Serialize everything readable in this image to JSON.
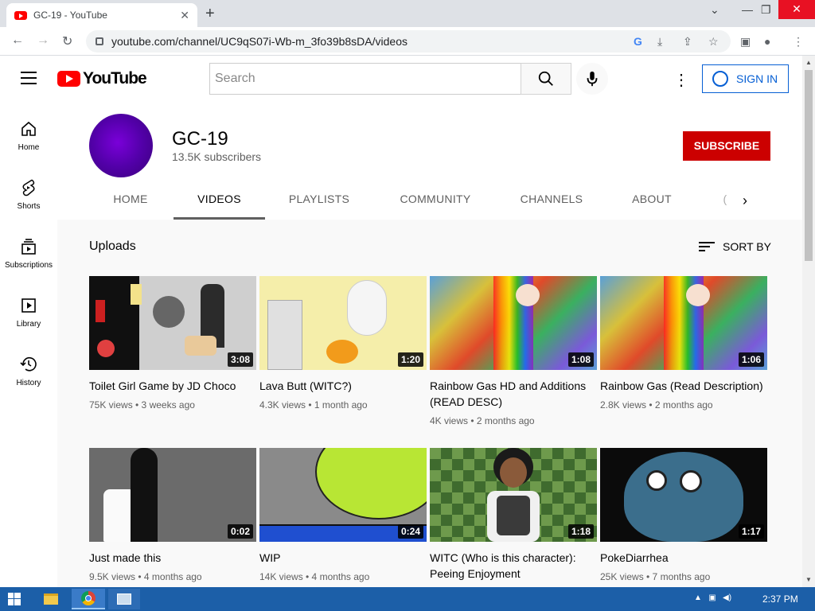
{
  "browser": {
    "tab_title": "GC-19 - YouTube",
    "close_glyph": "✕",
    "new_tab_glyph": "+",
    "url": "youtube.com/channel/UC9qS07i-Wb-m_3fo39b8sDA/videos"
  },
  "masthead": {
    "logo_text": "YouTube",
    "search_placeholder": "Search",
    "sign_in": "SIGN IN"
  },
  "guide": {
    "items": [
      {
        "label": "Home"
      },
      {
        "label": "Shorts"
      },
      {
        "label": "Subscriptions"
      },
      {
        "label": "Library"
      },
      {
        "label": "History"
      }
    ]
  },
  "channel": {
    "name": "GC-19",
    "subscribers": "13.5K subscribers",
    "subscribe_label": "SUBSCRIBE",
    "tabs": [
      "HOME",
      "VIDEOS",
      "PLAYLISTS",
      "COMMUNITY",
      "CHANNELS",
      "ABOUT"
    ],
    "active_tab": "VIDEOS"
  },
  "content": {
    "section_title": "Uploads",
    "sort_label": "SORT BY",
    "videos": [
      {
        "title": "Toilet Girl Game by JD Choco",
        "meta": "75K views • 3 weeks ago",
        "duration": "3:08"
      },
      {
        "title": "Lava Butt (WITC?)",
        "meta": "4.3K views • 1 month ago",
        "duration": "1:20"
      },
      {
        "title": "Rainbow Gas HD and Additions (READ DESC)",
        "meta": "4K views • 2 months ago",
        "duration": "1:08"
      },
      {
        "title": "Rainbow Gas (Read Description)",
        "meta": "2.8K views • 2 months ago",
        "duration": "1:06"
      },
      {
        "title": "Just made this",
        "meta": "9.5K views • 4 months ago",
        "duration": "0:02"
      },
      {
        "title": "WIP",
        "meta": "14K views • 4 months ago",
        "duration": "0:24"
      },
      {
        "title": "WITC (Who is this character): Peeing Enjoyment",
        "meta": "",
        "duration": "1:18"
      },
      {
        "title": "PokeDiarrhea",
        "meta": "25K views • 7 months ago",
        "duration": "1:17"
      }
    ]
  },
  "taskbar": {
    "clock": "2:37 PM"
  },
  "colors": {
    "subscribe_red": "#cc0000",
    "link_blue": "#065fd4",
    "taskbar_blue": "#1c5fa8"
  }
}
